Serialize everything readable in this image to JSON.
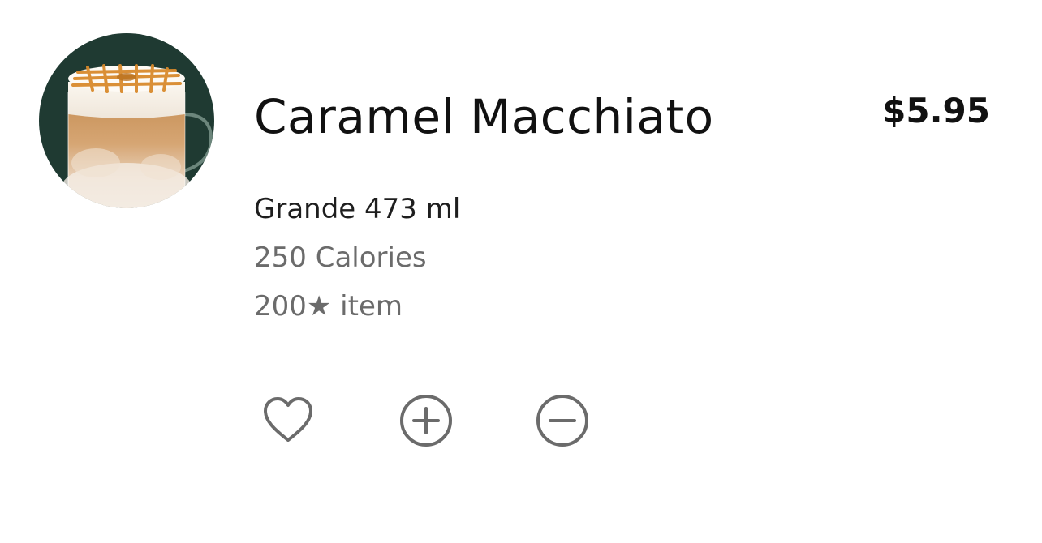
{
  "product": {
    "name": "Caramel Macchiato",
    "price": "$5.95",
    "size": "Grande 473 ml",
    "calories": "250 Calories",
    "stars": "200★ item",
    "image_icon": "caramel-macchiato-drink-image"
  },
  "actions": {
    "favorite_icon": "heart-icon",
    "add_icon": "plus-circle-icon",
    "remove_icon": "minus-circle-icon"
  },
  "colors": {
    "image_bg": "#1f3a32",
    "text_primary": "#111111",
    "text_secondary": "#6b6b6b",
    "icon_stroke": "#6b6b6b"
  }
}
